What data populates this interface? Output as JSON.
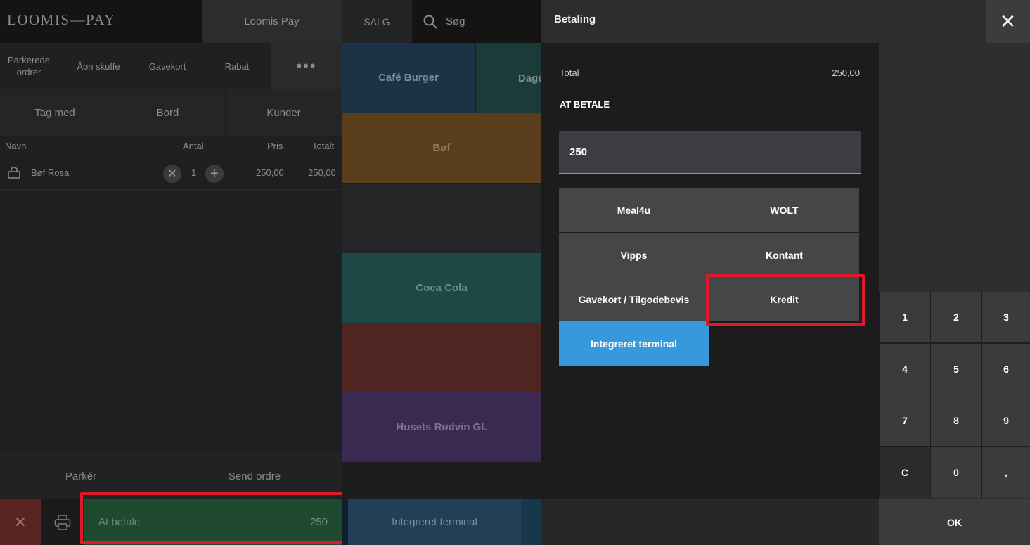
{
  "topbar": {
    "logo": "LOOMIS—PAY",
    "tab_loomis": "Loomis Pay",
    "tab_salg": "SALG",
    "search_label": "Søg"
  },
  "actions": {
    "parked_orders": "Parkerede ordrer",
    "open_drawer": "Åbn skuffe",
    "gift_card": "Gavekort",
    "discount": "Rabat",
    "more": "•••"
  },
  "modes": {
    "takeaway": "Tag med",
    "table": "Bord",
    "customers": "Kunder"
  },
  "order": {
    "columns": {
      "name": "Navn",
      "qty": "Antal",
      "price": "Pris",
      "total": "Totalt"
    },
    "items": [
      {
        "name": "Bøf Rosa",
        "qty": "1",
        "price": "250,00",
        "total": "250,00"
      }
    ]
  },
  "bottom": {
    "park": "Parkér",
    "send_order": "Send ordre",
    "pay_label": "At betale",
    "pay_amount": "250"
  },
  "products": {
    "cafe_burger": "Café Burger",
    "dage_partial": "Dage",
    "bof": "Bøf",
    "coca_cola": "Coca Cola",
    "husets_rodvin": "Husets Rødvin Gl.",
    "integrated_terminal": "Integreret terminal"
  },
  "colors": {
    "accent_orange": "#e8892a",
    "terminal_blue": "#3599db",
    "highlight_red": "#e0192a"
  },
  "modal": {
    "title": "Betaling",
    "total_label": "Total",
    "total_value": "250,00",
    "to_pay_label": "AT BETALE",
    "amount_value": "250",
    "methods": {
      "meal4u": "Meal4u",
      "wolt": "WOLT",
      "vipps": "Vipps",
      "kontant": "Kontant",
      "gavekort": "Gavekort / Tilgodebevis",
      "kredit": "Kredit",
      "terminal": "Integreret terminal"
    },
    "keypad": [
      "1",
      "2",
      "3",
      "4",
      "5",
      "6",
      "7",
      "8",
      "9",
      "C",
      "0",
      ","
    ],
    "ok": "OK"
  }
}
